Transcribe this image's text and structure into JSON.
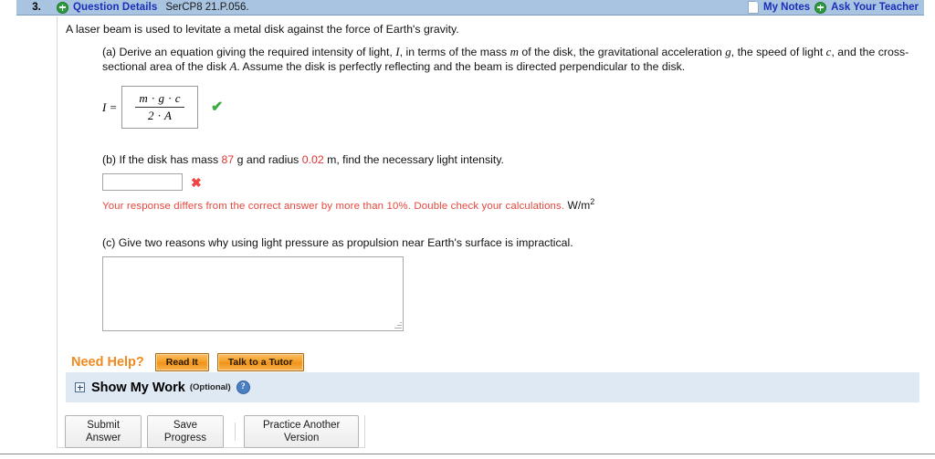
{
  "header": {
    "question_number": "3.",
    "expand_icon": "plus-circle-icon",
    "details_label": "Question Details",
    "question_code": "SerCP8 21.P.056.",
    "notes_icon": "note-page-icon",
    "notes_label": "My Notes",
    "teacher_icon": "plus-circle-icon",
    "teacher_label": "Ask Your Teacher",
    "bar_color": "#a8c4e0",
    "link_color": "#1a2fb8"
  },
  "question": {
    "intro": "A laser beam is used to levitate a metal disk against the force of Earth's gravity.",
    "part_a": {
      "prefix": "(a) Derive an equation giving the required intensity of light, ",
      "var_I": "I",
      "mid1": ", in terms of the mass ",
      "var_m": "m",
      "mid2": " of the disk, the gravitational acceleration ",
      "var_g": "g",
      "mid3": ", the speed of light ",
      "var_c": "c",
      "mid4": ", and the cross-sectional area of the disk ",
      "var_A": "A",
      "suffix": ". Assume the disk is perfectly reflecting and the beam is directed perpendicular to the disk.",
      "equation_lhs": "I =",
      "equation_numerator": "m · g · c",
      "equation_denominator": "2 · A",
      "status_icon": "green-check-icon",
      "status_mark": "✔"
    },
    "part_b": {
      "prefix": "(b) If the disk has mass ",
      "mass_value": "87",
      "mid1": " g and radius ",
      "radius_value": "0.02",
      "suffix": " m, find the necessary light intensity.",
      "input_value": "",
      "input_placeholder": "",
      "status_icon": "red-x-icon",
      "status_mark": "✖",
      "feedback": "Your response differs from the correct answer by more than 10%. Double check your calculations.",
      "unit": "W/m",
      "unit_exponent": "2",
      "highlight_color": "#e03030",
      "feedback_color": "#e8453c"
    },
    "part_c": {
      "text": "(c) Give two reasons why using light pressure as propulsion near Earth's surface is impractical.",
      "textarea_value": "",
      "textarea_placeholder": ""
    }
  },
  "need_help": {
    "label": "Need Help?",
    "label_color": "#f08a20",
    "buttons": [
      {
        "label": "Read It"
      },
      {
        "label": "Talk to a Tutor"
      }
    ]
  },
  "show_my_work": {
    "expand_icon": "expand-plus-box-icon",
    "title": "Show My Work",
    "optional": "(Optional)",
    "help_icon": "question-mark-help-icon",
    "help_glyph": "?",
    "background_color": "#dfe9f3"
  },
  "footer": {
    "buttons": [
      {
        "label": "Submit Answer"
      },
      {
        "label": "Save Progress"
      },
      {
        "label": "Practice Another Version"
      }
    ]
  }
}
